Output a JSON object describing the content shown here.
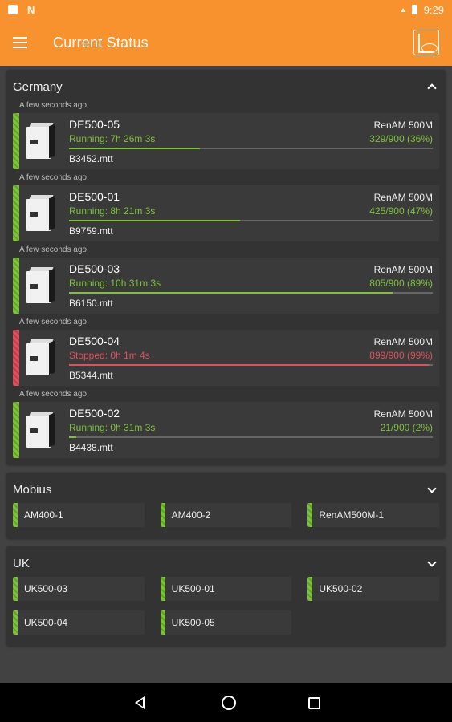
{
  "statusbar": {
    "time": "9:29"
  },
  "appbar": {
    "title": "Current Status"
  },
  "colors": {
    "accent": "#f7922f",
    "running": "#7cc33a",
    "stopped": "#e0505c"
  },
  "groups": [
    {
      "name": "Germany",
      "expanded": true,
      "machines": [
        {
          "updated": "A few seconds ago",
          "name": "DE500-05",
          "model": "RenAM 500M",
          "status": "Running: 7h 26m 3s",
          "state": "running",
          "layers": "329/900 (36%)",
          "progress": 0.36,
          "file": "B3452.mtt"
        },
        {
          "updated": "A few seconds ago",
          "name": "DE500-01",
          "model": "RenAM 500M",
          "status": "Running: 8h 21m 3s",
          "state": "running",
          "layers": "425/900 (47%)",
          "progress": 0.47,
          "file": "B9759.mtt"
        },
        {
          "updated": "A few seconds ago",
          "name": "DE500-03",
          "model": "RenAM 500M",
          "status": "Running: 10h 31m 3s",
          "state": "running",
          "layers": "805/900 (89%)",
          "progress": 0.89,
          "file": "B6150.mtt"
        },
        {
          "updated": "A few seconds ago",
          "name": "DE500-04",
          "model": "RenAM 500M",
          "status": "Stopped: 0h 1m 4s",
          "state": "stopped",
          "layers": "899/900 (99%)",
          "progress": 0.99,
          "file": "B5344.mtt"
        },
        {
          "updated": "A few seconds ago",
          "name": "DE500-02",
          "model": "RenAM 500M",
          "status": "Running: 0h 31m 3s",
          "state": "running",
          "layers": "21/900 (2%)",
          "progress": 0.02,
          "file": "B4438.mtt"
        }
      ]
    },
    {
      "name": "Mobius",
      "expanded": false,
      "tiles": [
        "AM400-1",
        "AM400-2",
        "RenAM500M-1"
      ]
    },
    {
      "name": "UK",
      "expanded": false,
      "tiles": [
        "UK500-03",
        "UK500-01",
        "UK500-02",
        "UK500-04",
        "UK500-05"
      ]
    }
  ]
}
